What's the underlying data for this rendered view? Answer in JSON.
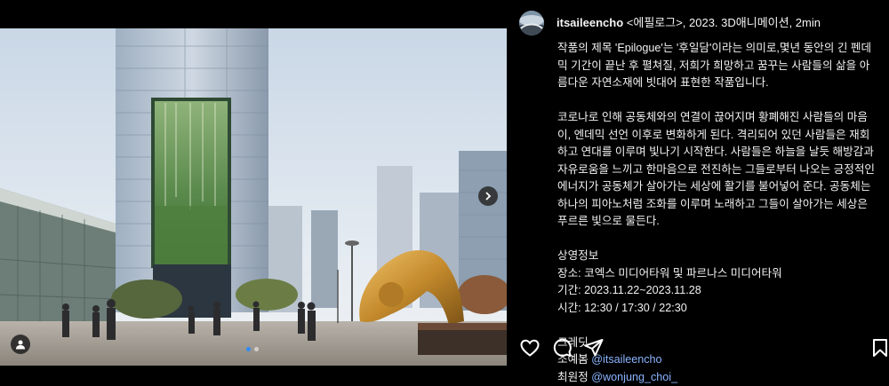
{
  "post": {
    "username": "itsaileencho",
    "title_line": "<에필로그>, 2023. 3D애니메이션, 2min",
    "paragraph1": "작품의 제목 'Epilogue'는 '후일담'이라는 의미로,몇년 동안의 긴 펜데믹 기간이 끝난 후 펼쳐질, 저희가 희망하고 꿈꾸는 사람들의 삶을 아름다운 자연소재에 빗대어 표현한 작품입니다.",
    "paragraph2": "코로나로 인해 공동체와의 연결이 끊어지며 황폐해진 사람들의 마음이, 엔데믹 선언 이후로 변화하게 된다. 격리되어 있던 사람들은 재회하고 연대를 이루며 빛나기 시작한다. 사람들은 하늘을 날듯 해방감과 자유로움을 느끼고 한마음으로 전진하는 그들로부터 나오는 긍정적인 에너지가 공동체가 살아가는 세상에 활기를 불어넣어 준다. 공동체는 하나의 피아노처럼 조화를 이루며 노래하고 그들이 살아가는 세상은 푸르른 빛으로 물든다.",
    "screening": {
      "heading": "상영정보",
      "venue": "장소: 코엑스 미디어타워 및 파르나스 미디어타워",
      "period": "기간: 2023.11.22~2023.11.28",
      "times": "시간: 12:30 / 17:30 / 22:30"
    },
    "credits": {
      "heading": "크레딧",
      "person1_name": "조예봄",
      "person1_handle": "@itsaileencho",
      "person2_name": "최원정",
      "person2_handle": "@wonjung_choi_"
    }
  },
  "carousel": {
    "current": 1,
    "total": 2
  },
  "actions": [
    "like-icon",
    "comment-icon",
    "share-icon",
    "save-icon"
  ],
  "colors": {
    "background": "#000000",
    "text": "#f5f5f5",
    "mention": "#8ab4ff",
    "active_dot": "#2f8cff"
  }
}
